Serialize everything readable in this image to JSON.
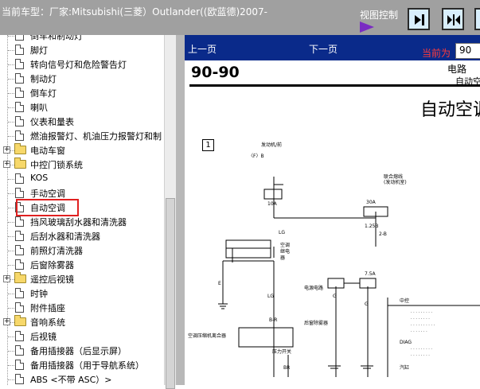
{
  "header": {
    "title": "当前车型：厂家:Mitsubishi(三菱）Outlander((欧蓝德)2007-",
    "view_control_label": "视图控制"
  },
  "tree": {
    "items": [
      {
        "label": "倒车和制动灯",
        "kind": "doc"
      },
      {
        "label": "脚灯",
        "kind": "doc"
      },
      {
        "label": "转向信号灯和危险警告灯",
        "kind": "doc"
      },
      {
        "label": "制动灯",
        "kind": "doc"
      },
      {
        "label": "倒车灯",
        "kind": "doc"
      },
      {
        "label": "喇叭",
        "kind": "doc"
      },
      {
        "label": "仪表和量表",
        "kind": "doc"
      },
      {
        "label": "燃油报警灯、机油压力报警灯和制",
        "kind": "doc"
      },
      {
        "label": "电动车窗",
        "kind": "folder"
      },
      {
        "label": "中控门锁系统",
        "kind": "folder"
      },
      {
        "label": "KOS",
        "kind": "doc"
      },
      {
        "label": "手动空调",
        "kind": "doc"
      },
      {
        "label": "自动空调",
        "kind": "doc",
        "selected": true
      },
      {
        "label": "挡风玻璃刮水器和清洗器",
        "kind": "doc"
      },
      {
        "label": "后刮水器和清洗器",
        "kind": "doc"
      },
      {
        "label": "前照灯清洗器",
        "kind": "doc"
      },
      {
        "label": "后窗除雾器",
        "kind": "doc"
      },
      {
        "label": "遥控后视镜",
        "kind": "folder"
      },
      {
        "label": "时钟",
        "kind": "doc"
      },
      {
        "label": "附件插座",
        "kind": "doc"
      },
      {
        "label": "音响系统",
        "kind": "folder"
      },
      {
        "label": "后视镜",
        "kind": "doc"
      },
      {
        "label": "备用插接器（后显示屏）",
        "kind": "doc"
      },
      {
        "label": "备用插接器（用于导航系统）",
        "kind": "doc"
      },
      {
        "label": "ABS <不带 ASC）>",
        "kind": "doc"
      }
    ]
  },
  "viewer": {
    "prev_label": "上一页",
    "next_label": "下一页",
    "current_label": "当前为",
    "page_value": "90",
    "page_code": "90-90",
    "header_line1": "电路",
    "header_line2": "自动空",
    "doc_title": "自动空调",
    "section_number": "1"
  },
  "diagram": {
    "labels": [
      "发动机/前",
      "〈F〉B",
      "联合熔线",
      "(发动机室)",
      "空调",
      "继电",
      "器",
      "电源电路",
      "G",
      "E",
      "LG",
      "中控",
      "后窗除雾器",
      "空调压缩机离合器",
      "压力开关",
      "BR",
      "DIAG",
      "汽缸"
    ],
    "fuse_values": [
      "10A",
      "30A",
      "7.5A"
    ],
    "wire_codes": [
      "1.25B",
      "2-B",
      "B-R",
      "LG",
      "G"
    ]
  },
  "colors": {
    "topbar": "#a0a0a0",
    "navbar": "#0a2a8a",
    "selection_outline": "#e02020",
    "arrow": "#7a2cc2"
  }
}
